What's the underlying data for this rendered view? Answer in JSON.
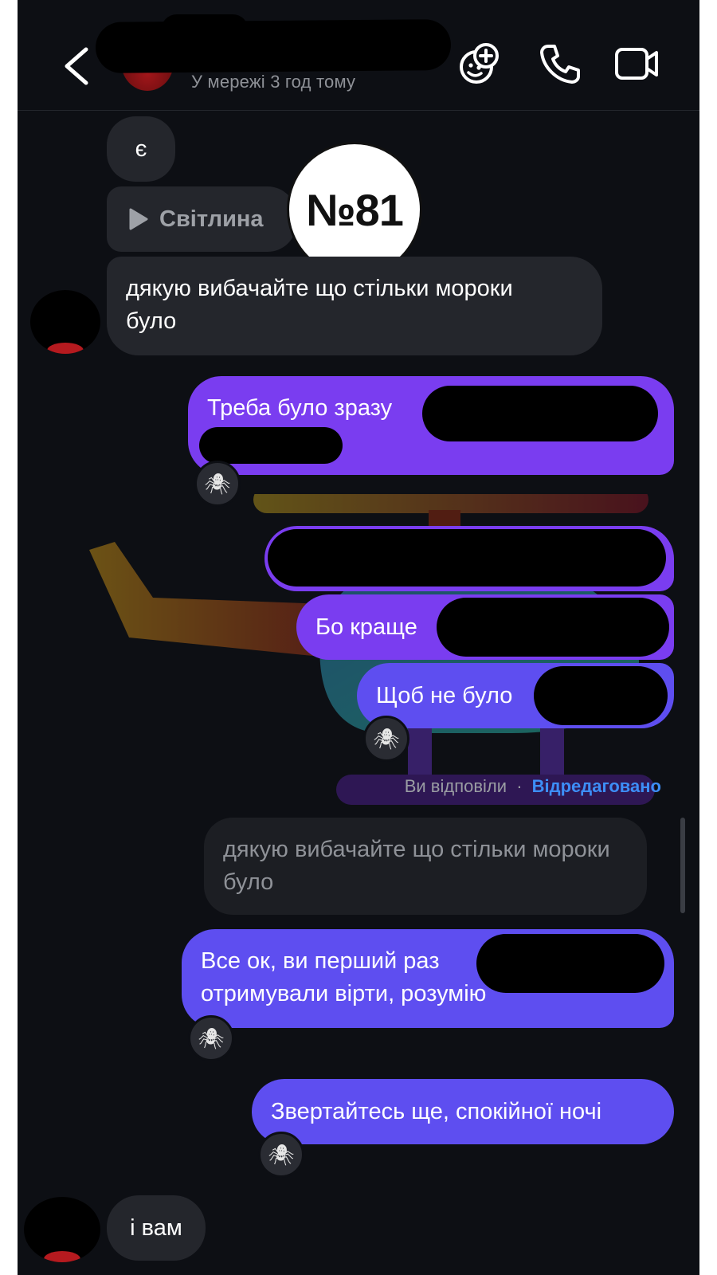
{
  "header": {
    "status": "У мережі 3 год тому",
    "icons": {
      "back": "chevron-left-icon",
      "effects": "face-plus-icon",
      "call": "phone-icon",
      "video": "video-camera-icon"
    }
  },
  "badge": {
    "text": "№81"
  },
  "messages": {
    "m1": {
      "text": "є"
    },
    "m2": {
      "text": "Світлина",
      "icon": "play-icon"
    },
    "m3": {
      "line1": "дякую вибачайте що стільки мороки",
      "line2": "було"
    },
    "m4": {
      "line1": "Треба було зразу"
    },
    "m5": {
      "text": "Бо краще"
    },
    "m6": {
      "text": "Щоб не було"
    },
    "m7": {
      "line1": "Все ок, ви перший раз",
      "line2": "отримували вірти, розумію"
    },
    "m8": {
      "text": "Звертайтесь ще, спокійної ночі"
    },
    "m9": {
      "text": "і вам"
    }
  },
  "reply": {
    "label": "Ви відповіли",
    "separator": "·",
    "edited": "Відредаговано",
    "quote_line1": "дякую вибачайте що стільки мороки",
    "quote_line2": "було"
  },
  "reaction_emoji": "🕷",
  "colors": {
    "background": "#0d0f14",
    "incoming": "#24262c",
    "outgoing_purple": "#7a3df0",
    "outgoing_blue": "#5e4ef0",
    "link": "#3d8ef7"
  }
}
